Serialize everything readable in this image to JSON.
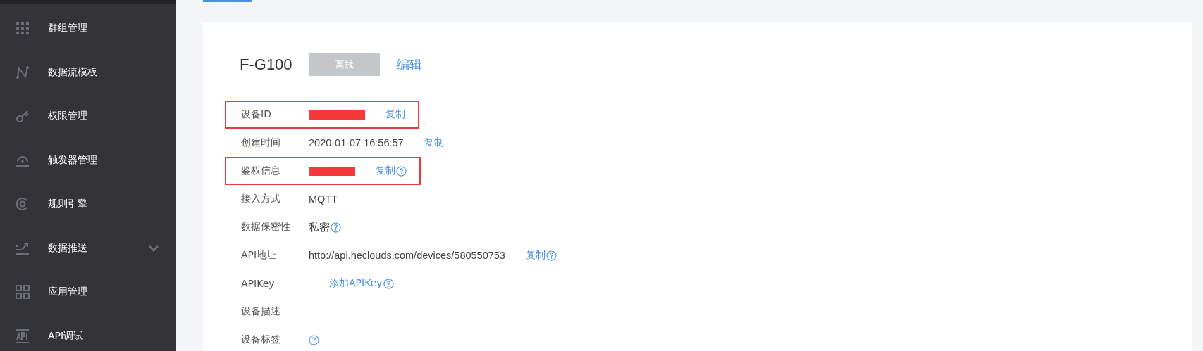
{
  "sidebar": {
    "items": [
      {
        "label": "群组管理"
      },
      {
        "label": "数据流模板"
      },
      {
        "label": "权限管理"
      },
      {
        "label": "触发器管理"
      },
      {
        "label": "规则引擎"
      },
      {
        "label": "数据推送",
        "expandable": true
      },
      {
        "label": "应用管理"
      },
      {
        "label": "API调试"
      }
    ]
  },
  "device": {
    "name": "F-G100",
    "status": "离线",
    "edit_link": "编辑",
    "fields": [
      {
        "label": "设备ID",
        "redacted": true,
        "highlighted": true,
        "action": "复制"
      },
      {
        "label": "创建时间",
        "value": "2020-01-07 16:56:57",
        "action": "复制"
      },
      {
        "label": "鉴权信息",
        "redacted": true,
        "highlighted": true,
        "action": "复制",
        "help": true
      },
      {
        "label": "接入方式",
        "value": "MQTT"
      },
      {
        "label": "数据保密性",
        "value": "私密",
        "help": true
      },
      {
        "label": "API地址",
        "value": "http://api.heclouds.com/devices/580550753",
        "action": "复制",
        "help": true
      },
      {
        "label": "APIKey",
        "action": "添加APIKey",
        "help": true
      },
      {
        "label": "设备描述"
      },
      {
        "label": "设备标签",
        "help": true
      }
    ]
  }
}
